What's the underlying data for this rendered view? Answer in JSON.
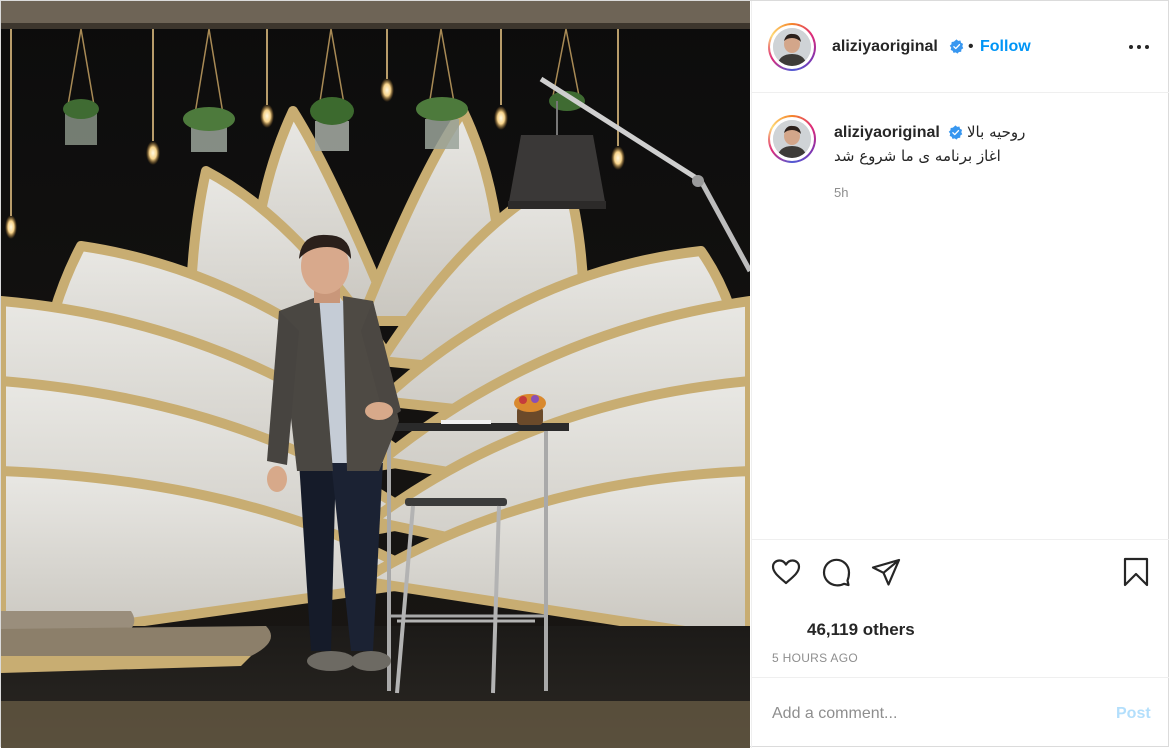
{
  "post": {
    "author": {
      "username": "aliziyaoriginal",
      "verified": true,
      "verified_color": "#3897f0",
      "avatar_icon": "profile-photo"
    },
    "header": {
      "separator": "•",
      "follow_label": "Follow",
      "follow_color": "#0095f6",
      "more_icon": "more-options-icon"
    },
    "caption": {
      "username": "aliziyaoriginal",
      "line1": "روحیه بالا",
      "line2": "اغاز برنامه ی ما شروع شد",
      "time": "5h"
    },
    "actions": {
      "like_icon": "heart-icon",
      "comment_icon": "comment-icon",
      "share_icon": "paper-plane-icon",
      "save_icon": "bookmark-icon"
    },
    "likes_text": "46,119 others",
    "timestamp": "5 HOURS AGO",
    "comment": {
      "placeholder": "Add a comment...",
      "value": "",
      "post_label": "Post",
      "post_color": "#b3dffc"
    }
  }
}
